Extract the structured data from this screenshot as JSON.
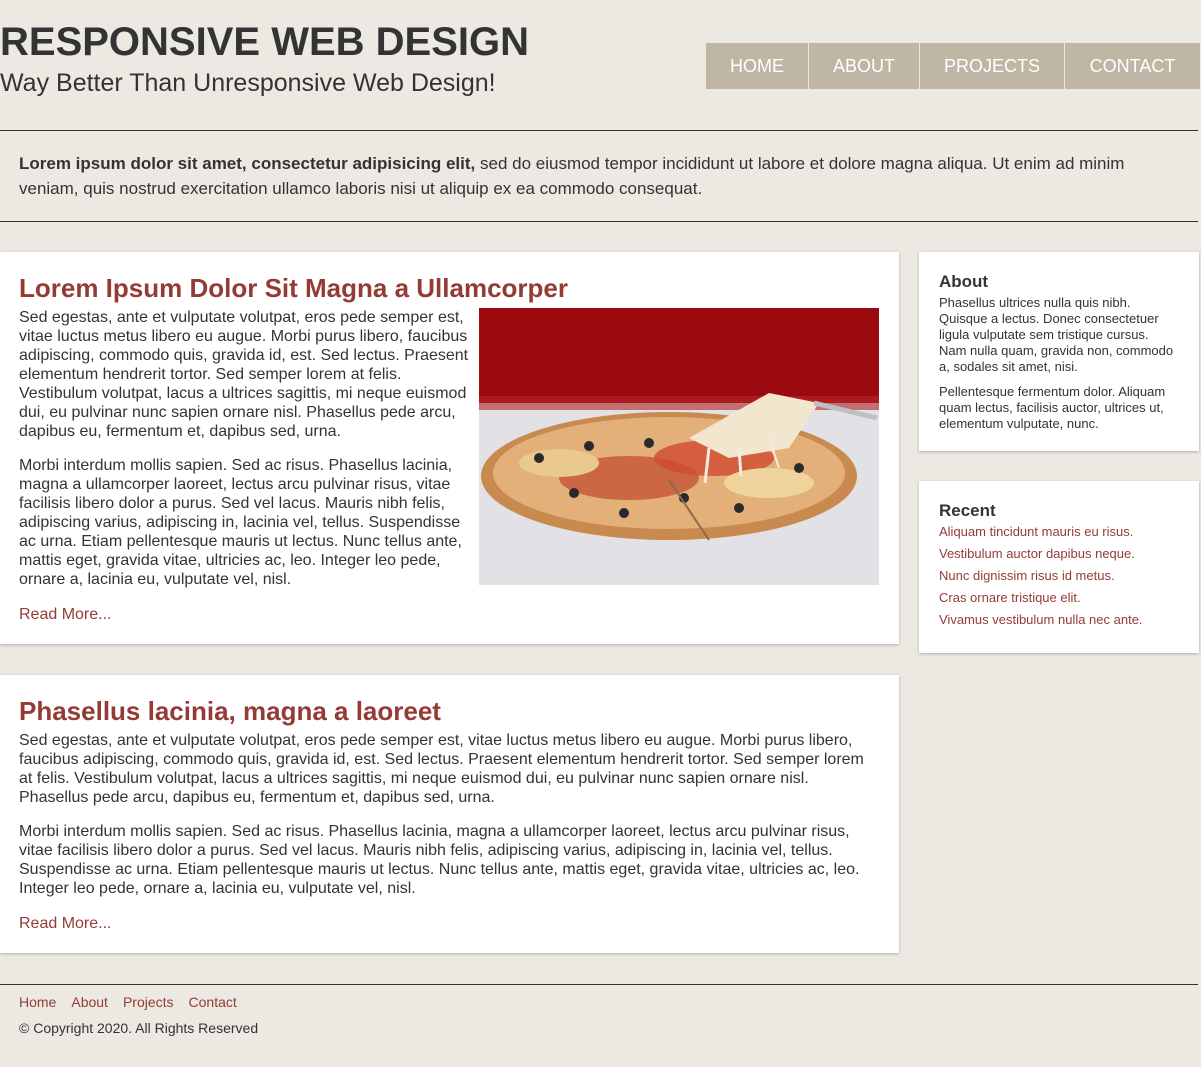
{
  "header": {
    "title": "RESPONSIVE WEB DESIGN",
    "tagline": "Way Better Than Unresponsive Web Design!"
  },
  "nav": {
    "items": [
      {
        "label": "HOME"
      },
      {
        "label": "ABOUT"
      },
      {
        "label": "PROJECTS"
      },
      {
        "label": "CONTACT"
      }
    ]
  },
  "intro": {
    "bold": "Lorem ipsum dolor sit amet, consectetur adipisicing elit,",
    "text": " sed do eiusmod tempor incididunt ut labore et dolore magna aliqua. Ut enim ad minim veniam, quis nostrud exercitation ullamco laboris nisi ut aliquip ex ea commodo consequat."
  },
  "articles": [
    {
      "title": "Lorem Ipsum Dolor Sit Magna a Ullamcorper",
      "p1": "Sed egestas, ante et vulputate volutpat, eros pede semper est, vitae luctus metus libero eu augue. Morbi purus libero, faucibus adipiscing, commodo quis, gravida id, est. Sed lectus. Praesent elementum hendrerit tortor. Sed semper lorem at felis. Vestibulum volutpat, lacus a ultrices sagittis, mi neque euismod dui, eu pulvinar nunc sapien ornare nisl. Phasellus pede arcu, dapibus eu, fermentum et, dapibus sed, urna.",
      "p2": "Morbi interdum mollis sapien. Sed ac risus. Phasellus lacinia, magna a ullamcorper laoreet, lectus arcu pulvinar risus, vitae facilisis libero dolor a purus. Sed vel lacus. Mauris nibh felis, adipiscing varius, adipiscing in, lacinia vel, tellus. Suspendisse ac urna. Etiam pellentesque mauris ut lectus. Nunc tellus ante, mattis eget, gravida vitae, ultricies ac, leo. Integer leo pede, ornare a, lacinia eu, vulputate vel, nisl.",
      "read_more": "Read More..."
    },
    {
      "title": "Phasellus lacinia, magna a laoreet",
      "p1": "Sed egestas, ante et vulputate volutpat, eros pede semper est, vitae luctus metus libero eu augue. Morbi purus libero, faucibus adipiscing, commodo quis, gravida id, est. Sed lectus. Praesent elementum hendrerit tortor. Sed semper lorem at felis. Vestibulum volutpat, lacus a ultrices sagittis, mi neque euismod dui, eu pulvinar nunc sapien ornare nisl. Phasellus pede arcu, dapibus eu, fermentum et, dapibus sed, urna.",
      "p2": "Morbi interdum mollis sapien. Sed ac risus. Phasellus lacinia, magna a ullamcorper laoreet, lectus arcu pulvinar risus, vitae facilisis libero dolor a purus. Sed vel lacus. Mauris nibh felis, adipiscing varius, adipiscing in, lacinia vel, tellus. Suspendisse ac urna. Etiam pellentesque mauris ut lectus. Nunc tellus ante, mattis eget, gravida vitae, ultricies ac, leo. Integer leo pede, ornare a, lacinia eu, vulputate vel, nisl.",
      "read_more": "Read More..."
    }
  ],
  "sidebar": {
    "about": {
      "heading": "About",
      "p1": "Phasellus ultrices nulla quis nibh. Quisque a lectus. Donec consectetuer ligula vulputate sem tristique cursus. Nam nulla quam, gravida non, commodo a, sodales sit amet, nisi.",
      "p2": "Pellentesque fermentum dolor. Aliquam quam lectus, facilisis auctor, ultrices ut, elementum vulputate, nunc."
    },
    "recent": {
      "heading": "Recent",
      "links": [
        "Aliquam tincidunt mauris eu risus.",
        "Vestibulum auctor dapibus neque.",
        "Nunc dignissim risus id metus.",
        "Cras ornare tristique elit.",
        "Vivamus vestibulum nulla nec ante."
      ]
    }
  },
  "footer": {
    "links": [
      "Home",
      "About",
      "Projects",
      "Contact"
    ],
    "copyright": "© Copyright 2020. All Rights Reserved"
  },
  "colors": {
    "background": "#ece9e2",
    "nav": "#c0b6a5",
    "accent": "#943b35",
    "text": "#333333"
  }
}
